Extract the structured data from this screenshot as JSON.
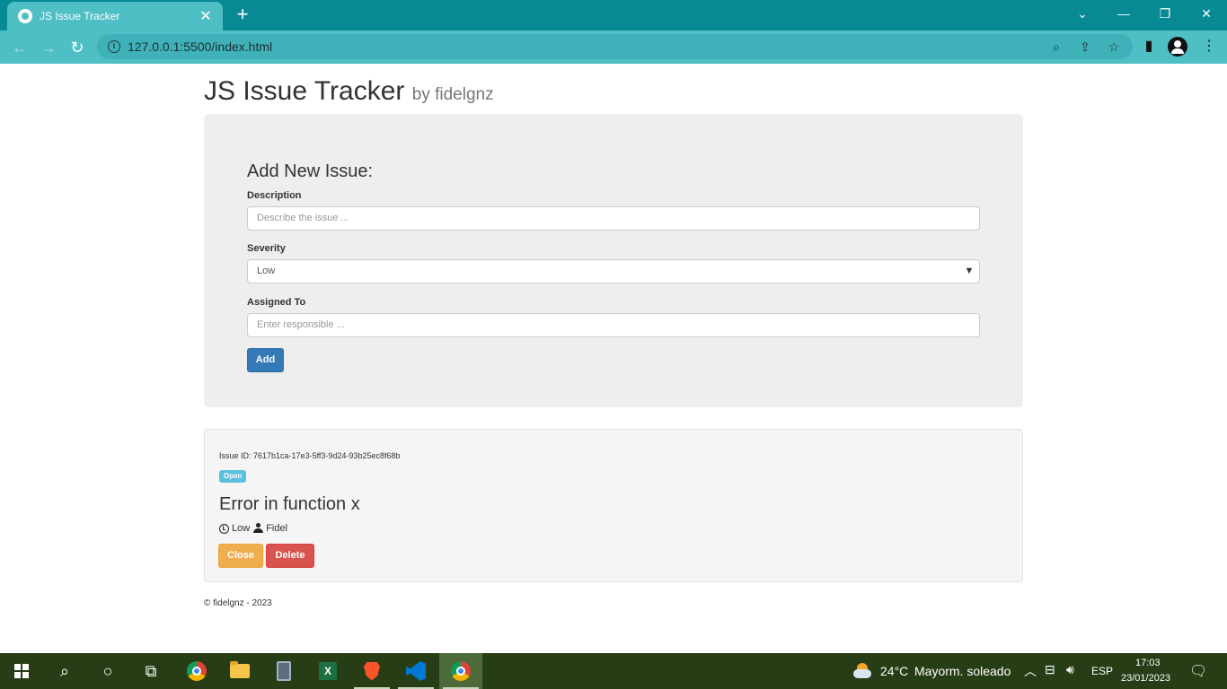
{
  "browser": {
    "tab_title": "JS Issue Tracker",
    "url": "127.0.0.1:5500/index.html"
  },
  "page": {
    "title": "JS Issue Tracker",
    "subtitle": "by fidelgnz",
    "form": {
      "heading": "Add New Issue:",
      "description_label": "Description",
      "description_placeholder": "Describe the issue ...",
      "severity_label": "Severity",
      "severity_value": "Low",
      "assigned_label": "Assigned To",
      "assigned_placeholder": "Enter responsible ...",
      "add_button": "Add"
    },
    "issues": [
      {
        "id_text": "Issue ID: 7617b1ca-17e3-5ff3-9d24-93b25ec8f68b",
        "status": "Open",
        "title": "Error in function x",
        "severity": "Low",
        "assignee": "Fidel",
        "close_button": "Close",
        "delete_button": "Delete"
      }
    ],
    "footer": "© fidelgnz - 2023"
  },
  "taskbar": {
    "temperature": "24°C",
    "weather": "Mayorm. soleado",
    "language": "ESP",
    "time": "17:03",
    "date": "23/01/2023"
  },
  "colors": {
    "tabbar": "#078a93",
    "toolbar": "#4fbfc6",
    "primary": "#337ab7",
    "warning": "#f0ad4e",
    "danger": "#d9534f",
    "info": "#5bc0de",
    "taskbar": "#273d16"
  }
}
